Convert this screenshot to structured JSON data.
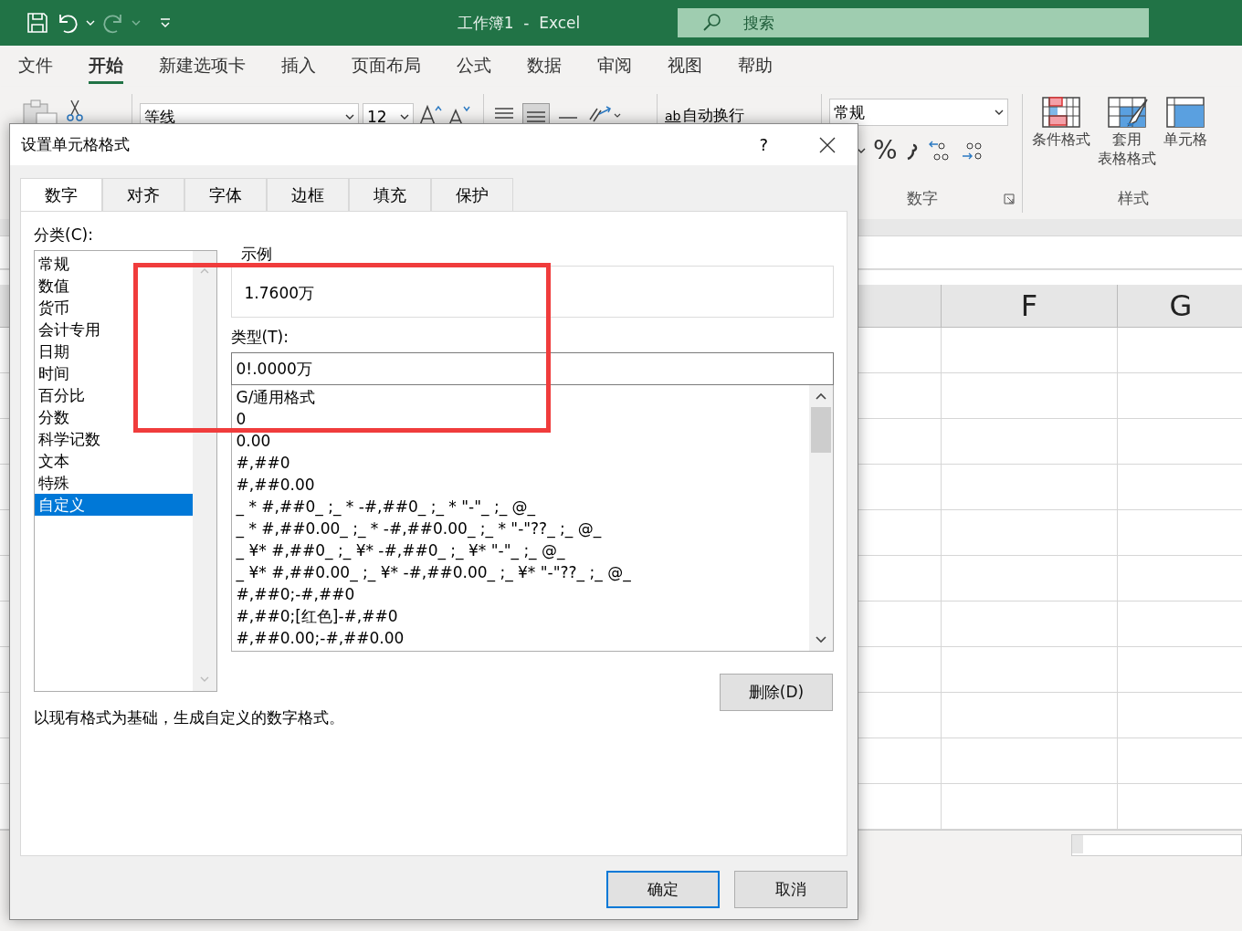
{
  "title_bar": {
    "title": "工作簿1  -  Excel",
    "search": {
      "placeholder": "搜索"
    }
  },
  "ribbon_tabs": [
    {
      "label": "文件",
      "selected": false
    },
    {
      "label": "开始",
      "selected": true
    },
    {
      "label": "新建选项卡",
      "selected": false
    },
    {
      "label": "插入",
      "selected": false
    },
    {
      "label": "页面布局",
      "selected": false
    },
    {
      "label": "公式",
      "selected": false
    },
    {
      "label": "数据",
      "selected": false
    },
    {
      "label": "审阅",
      "selected": false
    },
    {
      "label": "视图",
      "selected": false
    },
    {
      "label": "帮助",
      "selected": false
    }
  ],
  "ribbon": {
    "font": "等线",
    "font_size": "12",
    "wrap_glyph": "ab",
    "wrap_text": "自动换行",
    "percent_symbol": "%",
    "number_format": "常规",
    "number_group_label": "数字",
    "styles_group_label": "样式",
    "style_buttons": [
      {
        "kind": "conditional",
        "lines": [
          "条件格式"
        ]
      },
      {
        "kind": "table",
        "lines": [
          "套用",
          "表格格式"
        ]
      },
      {
        "kind": "cell",
        "lines": [
          "单元格"
        ]
      }
    ]
  },
  "columns": [
    "F",
    "G"
  ],
  "dialog": {
    "title": "设置单元格格式",
    "help": "?",
    "tabs": [
      {
        "label": "数字",
        "selected": true
      },
      {
        "label": "对齐",
        "selected": false
      },
      {
        "label": "字体",
        "selected": false
      },
      {
        "label": "边框",
        "selected": false
      },
      {
        "label": "填充",
        "selected": false
      },
      {
        "label": "保护",
        "selected": false
      }
    ],
    "category_label": "分类(C):",
    "categories": [
      {
        "label": "常规",
        "selected": false
      },
      {
        "label": "数值",
        "selected": false
      },
      {
        "label": "货币",
        "selected": false
      },
      {
        "label": "会计专用",
        "selected": false
      },
      {
        "label": "日期",
        "selected": false
      },
      {
        "label": "时间",
        "selected": false
      },
      {
        "label": "百分比",
        "selected": false
      },
      {
        "label": "分数",
        "selected": false
      },
      {
        "label": "科学记数",
        "selected": false
      },
      {
        "label": "文本",
        "selected": false
      },
      {
        "label": "特殊",
        "selected": false
      },
      {
        "label": "自定义",
        "selected": true
      }
    ],
    "sample_label": "示例",
    "sample": "1.7600万",
    "type_label": "类型(T):",
    "type_value": "0!.0000万",
    "formats": [
      "G/通用格式",
      "0",
      "0.00",
      "#,##0",
      "#,##0.00",
      "_ * #,##0_ ;_ * -#,##0_ ;_ * \"-\"_ ;_ @_",
      "_ * #,##0.00_ ;_ * -#,##0.00_ ;_ * \"-\"??_ ;_ @_",
      "_ ¥* #,##0_ ;_ ¥* -#,##0_ ;_ ¥* \"-\"_ ;_ @_",
      "_ ¥* #,##0.00_ ;_ ¥* -#,##0.00_ ;_ ¥* \"-\"??_ ;_ @_",
      "#,##0;-#,##0",
      "#,##0;[红色]-#,##0",
      "#,##0.00;-#,##0.00"
    ],
    "delete_button": "删除(D)",
    "description": "以现有格式为基础，生成自定义的数字格式。",
    "ok_button": "确定",
    "cancel_button": "取消"
  }
}
